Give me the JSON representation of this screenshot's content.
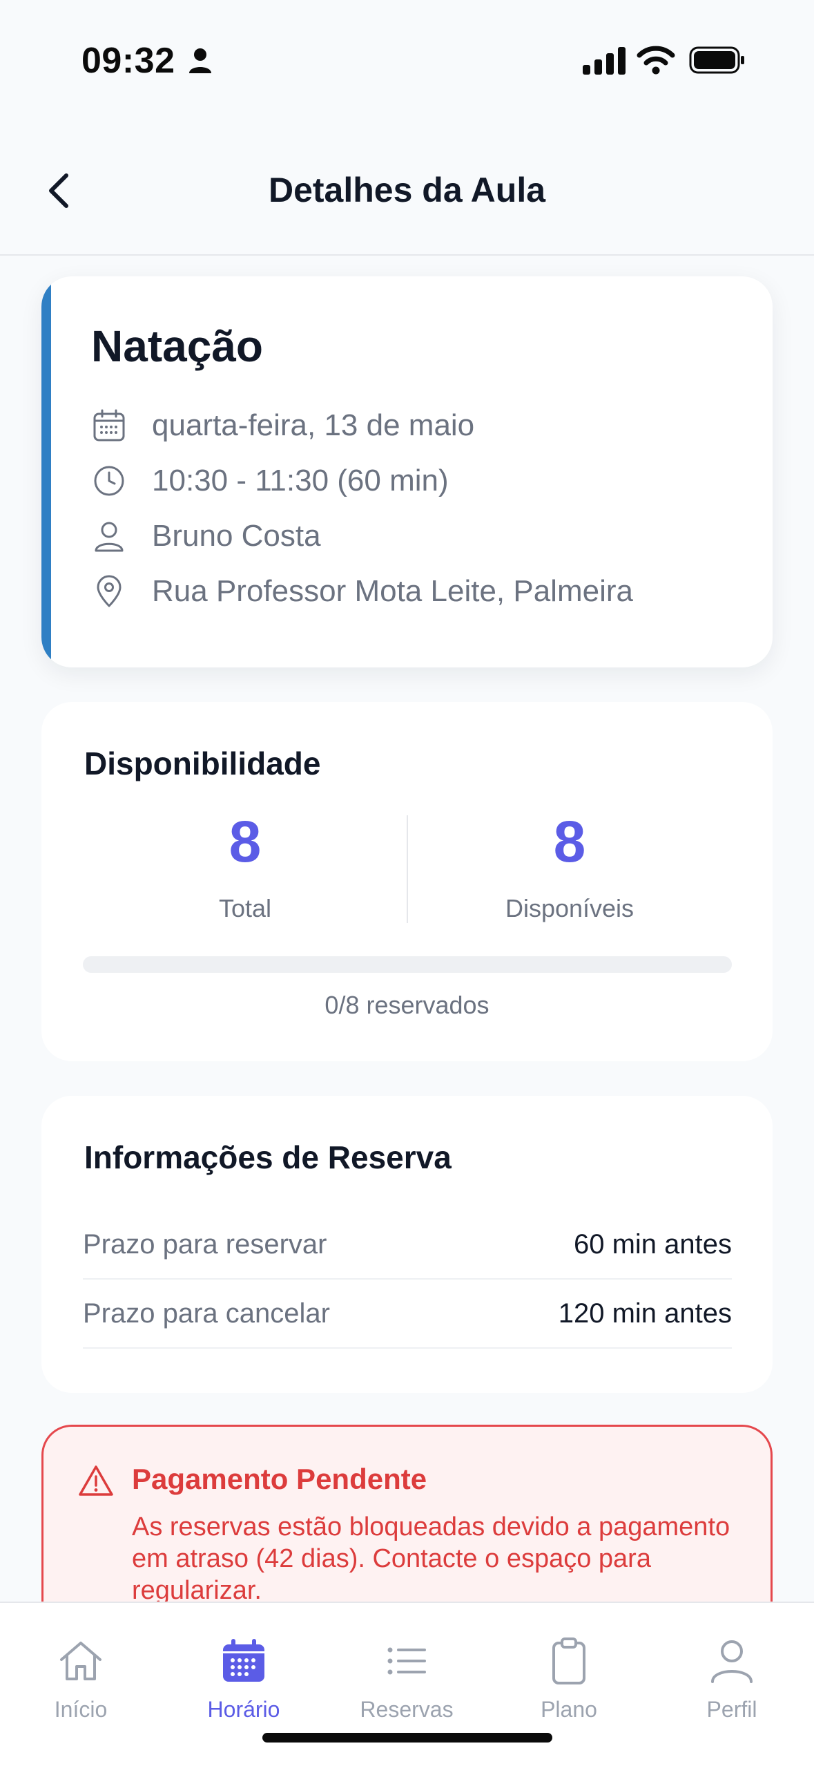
{
  "status_bar": {
    "time": "09:32"
  },
  "header": {
    "title": "Detalhes da Aula"
  },
  "class_card": {
    "accent_color": "#2f7fc4",
    "title": "Natação",
    "date": "quarta-feira, 13 de maio",
    "time": "10:30 - 11:30 (60 min)",
    "instructor": "Bruno Costa",
    "location": "Rua Professor Mota Leite, Palmeira"
  },
  "availability": {
    "title": "Disponibilidade",
    "total_value": "8",
    "total_label": "Total",
    "available_value": "8",
    "available_label": "Disponíveis",
    "booked_fraction": 0,
    "caption": "0/8 reservados"
  },
  "reservation_info": {
    "title": "Informações de Reserva",
    "rows": [
      {
        "label": "Prazo para reservar",
        "value": "60 min antes"
      },
      {
        "label": "Prazo para cancelar",
        "value": "120 min antes"
      }
    ]
  },
  "alert": {
    "title": "Pagamento Pendente",
    "message": "As reservas estão bloqueadas devido a pagamento em atraso (42 dias). Contacte o espaço para regularizar.",
    "color": "#dc3c3c"
  },
  "tab_bar": {
    "active_color": "#5b5ce6",
    "items": [
      {
        "label": "Início",
        "icon": "home-icon"
      },
      {
        "label": "Horário",
        "icon": "calendar-icon"
      },
      {
        "label": "Reservas",
        "icon": "list-icon"
      },
      {
        "label": "Plano",
        "icon": "clipboard-icon"
      },
      {
        "label": "Perfil",
        "icon": "user-icon"
      }
    ]
  }
}
